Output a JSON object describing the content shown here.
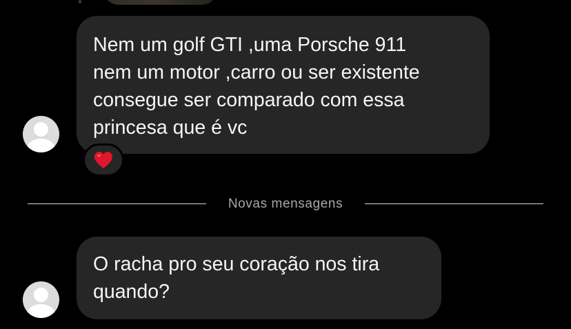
{
  "conversation": {
    "messages": [
      {
        "lines": [
          "Nem um golf GTI ,uma Porsche 911",
          "nem um motor ,carro ou ser existente",
          "consegue ser comparado com essa",
          "princesa que é vc"
        ],
        "reaction": {
          "icon": "red-heart-icon",
          "color": "#e0162b"
        }
      },
      {
        "lines": [
          "O racha pro seu coração nos tira",
          "quando?"
        ]
      }
    ],
    "divider_label": "Novas mensagens"
  },
  "colors": {
    "background": "#000000",
    "bubble": "#262626",
    "text": "#f5f5f5",
    "divider_text": "#a8a8a8",
    "avatar": "#dcdcdc"
  }
}
